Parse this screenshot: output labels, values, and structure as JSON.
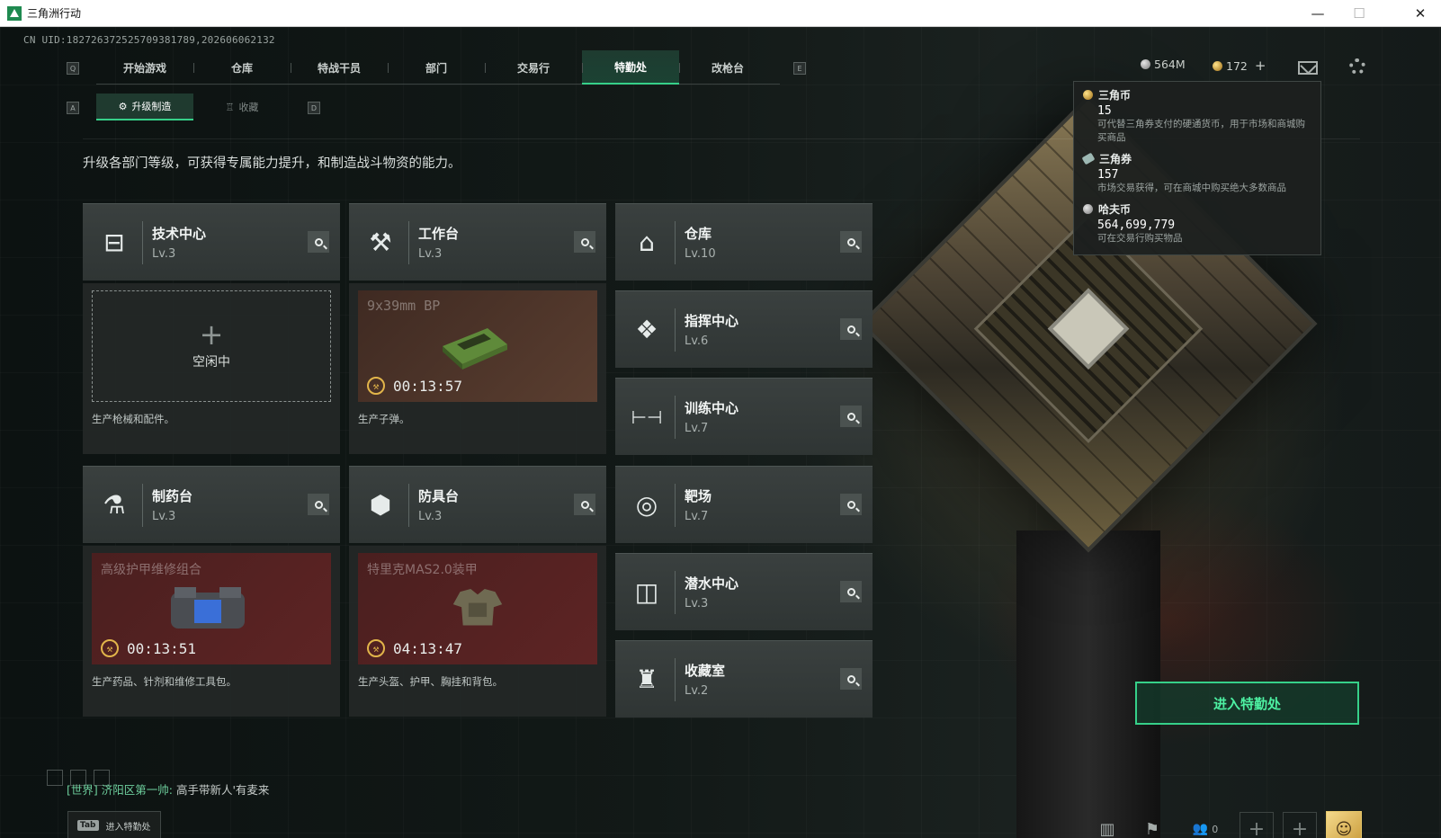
{
  "window": {
    "title": "三角洲行动",
    "controls": [
      "minimize-icon",
      "maximize-icon",
      "close-icon"
    ]
  },
  "uid_text": "CN UID:182726372525709381789,202606062132",
  "nav": {
    "left_key": "Q",
    "right_key": "E",
    "tabs": [
      "开始游戏",
      "仓库",
      "特战干员",
      "部门",
      "交易行",
      "特勤处",
      "改枪台"
    ],
    "active_tab": "特勤处"
  },
  "subnav": {
    "left_key": "A",
    "right_key": "D",
    "tabs": [
      {
        "label": "升级制造",
        "icon": "craft-icon",
        "active": true
      },
      {
        "label": "收藏",
        "icon": "trophy-icon",
        "active": false
      }
    ]
  },
  "intro_text": "升级各部门等级，可获得专属能力提升，和制造战斗物资的能力。",
  "currency": {
    "hafu_short": "564M",
    "coin_short": "172",
    "coin_plus": "+",
    "tooltip": [
      {
        "icon": "gold-coin-icon",
        "name": "三角币",
        "value": "15",
        "desc": "可代替三角券支付的硬通货币，用于市场和商城购买商品"
      },
      {
        "icon": "ticket-icon",
        "name": "三角券",
        "value": "157",
        "desc": "市场交易获得，可在商城中购买绝大多数商品"
      },
      {
        "icon": "silver-coin-icon",
        "name": "哈夫币",
        "value": "564,699,779",
        "desc": "可在交易行购买物品"
      }
    ]
  },
  "stations": {
    "tech": {
      "name": "技术中心",
      "level": "Lv.3",
      "icon": "monitor-icon",
      "glyph": "⊟"
    },
    "workbench": {
      "name": "工作台",
      "level": "Lv.3",
      "icon": "hammer-wrench-icon",
      "glyph": "⚒"
    },
    "storage": {
      "name": "仓库",
      "level": "Lv.10",
      "icon": "warehouse-icon",
      "glyph": "⌂"
    },
    "command": {
      "name": "指挥中心",
      "level": "Lv.6",
      "icon": "command-chip-icon",
      "glyph": "❖"
    },
    "training": {
      "name": "训练中心",
      "level": "Lv.7",
      "icon": "dumbbell-icon",
      "glyph": "⊢⊣"
    },
    "pharmacy": {
      "name": "制药台",
      "level": "Lv.3",
      "icon": "microscope-icon",
      "glyph": "⚗"
    },
    "armor": {
      "name": "防具台",
      "level": "Lv.3",
      "icon": "armor-blocks-icon",
      "glyph": "⬢"
    },
    "range": {
      "name": "靶场",
      "level": "Lv.7",
      "icon": "target-icon",
      "glyph": "◎"
    },
    "diving": {
      "name": "潜水中心",
      "level": "Lv.3",
      "icon": "diving-mask-icon",
      "glyph": "◫"
    },
    "collection": {
      "name": "收藏室",
      "level": "Lv.2",
      "icon": "collection-room-icon",
      "glyph": "♜"
    }
  },
  "slots": {
    "tech": {
      "state": "空闲中",
      "desc": "生产枪械和配件。"
    },
    "workbench": {
      "item": "9x39mm BP",
      "timer": "00:13:57",
      "desc": "生产子弹。"
    },
    "pharmacy": {
      "item": "高级护甲维修组合",
      "timer": "00:13:51",
      "desc": "生产药品、针剂和维修工具包。"
    },
    "armor": {
      "item": "特里克MAS2.0装甲",
      "timer": "04:13:47",
      "desc": "生产头盔、护甲、胸挂和背包。"
    }
  },
  "enter_button": "进入特勤处",
  "chat": {
    "channel": "[世界]",
    "player": "济阳区第一帅:",
    "message": "高手带新人'有麦来"
  },
  "tab_hint": {
    "key": "Tab",
    "label": "进入特勤处"
  },
  "friends_count": "0",
  "colors": {
    "accent": "#36d089",
    "card": "#353b3a",
    "timer": "#e2b54a"
  }
}
